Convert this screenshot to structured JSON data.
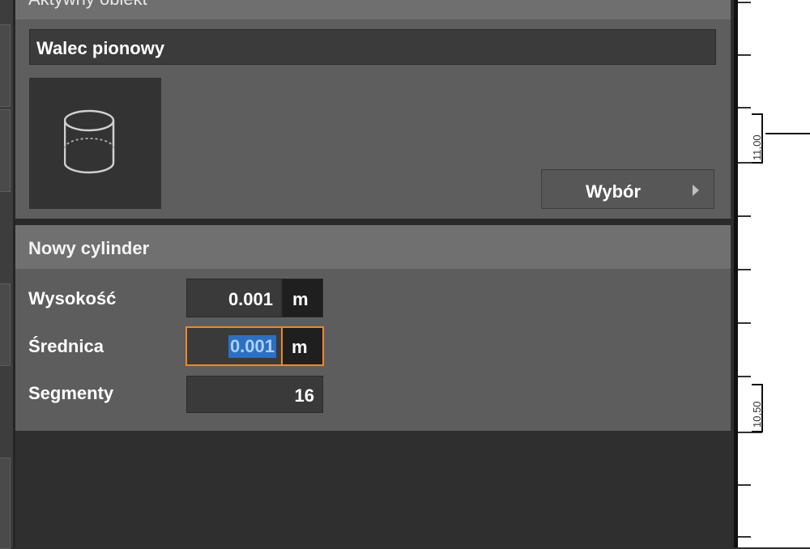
{
  "active_object": {
    "header": "Aktywny obiekt",
    "name": "Walec pionowy",
    "thumbnail_icon": "cylinder-icon",
    "select_button_label": "Wybór",
    "select_button_icon": "triangle-right-icon"
  },
  "new_cylinder": {
    "header": "Nowy cylinder",
    "height_label": "Wysokość",
    "height_value": "0.001",
    "height_unit": "m",
    "diameter_label": "Średnica",
    "diameter_value": "0.001",
    "diameter_unit": "m",
    "segments_label": "Segmenty",
    "segments_value": "16"
  },
  "ruler": {
    "label_top": "11,00",
    "label_bottom": "10,50"
  },
  "colors": {
    "focus_outline": "#e88a2e",
    "selection": "#2d6fc0"
  }
}
